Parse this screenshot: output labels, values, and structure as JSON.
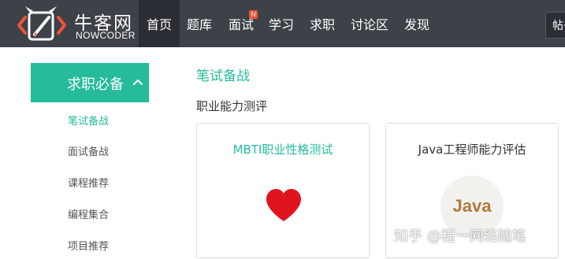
{
  "header": {
    "logo_title": "牛客网",
    "logo_subtitle": "NOWCODER",
    "nav": [
      {
        "label": "首页",
        "active": true
      },
      {
        "label": "题库"
      },
      {
        "label": "面试",
        "badge": "N"
      },
      {
        "label": "学习"
      },
      {
        "label": "求职"
      },
      {
        "label": "讨论区"
      },
      {
        "label": "发现"
      }
    ],
    "right_button_label": "帖子"
  },
  "sidebar": {
    "header_label": "求职必备",
    "items": [
      {
        "label": "笔试备战",
        "active": true
      },
      {
        "label": "面试备战"
      },
      {
        "label": "课程推荐"
      },
      {
        "label": "编程集合"
      },
      {
        "label": "项目推荐"
      }
    ]
  },
  "main": {
    "title": "笔试备战",
    "section_title": "职业能力测评",
    "cards": [
      {
        "title": "MBTI职业性格测试",
        "icon": "heart-icon"
      },
      {
        "title": "Java工程师能力评估",
        "icon_text": "Java"
      }
    ]
  },
  "watermark": "知乎 @程一网络随笔",
  "colors": {
    "topbar": "#3d4148",
    "accent": "#25bb9b",
    "logo_orange": "#f0543a",
    "heart": "#e0141e",
    "java_text": "#b07a3a"
  }
}
